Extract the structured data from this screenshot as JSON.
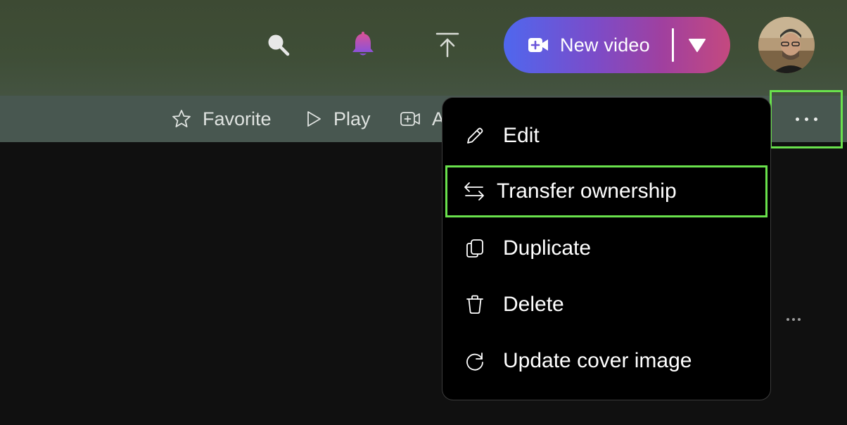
{
  "header": {
    "icons": [
      "search-icon",
      "bell-icon",
      "upload-icon"
    ],
    "new_video": {
      "label": "New video",
      "icon": "video-plus-icon",
      "caret": "chevron-down-icon"
    },
    "avatar": "user-avatar"
  },
  "toolbar": {
    "items": [
      {
        "label": "Favorite",
        "icon": "star-icon"
      },
      {
        "label": "Play",
        "icon": "play-icon"
      },
      {
        "label": "A",
        "icon": "add-video-icon"
      }
    ],
    "more_icon": "more-horizontal-icon"
  },
  "menu": {
    "items": [
      {
        "label": "Edit",
        "icon": "pencil-icon"
      },
      {
        "label": "Transfer ownership",
        "icon": "transfer-icon",
        "highlighted": true
      },
      {
        "label": "Duplicate",
        "icon": "copy-icon"
      },
      {
        "label": "Delete",
        "icon": "trash-icon"
      },
      {
        "label": "Update cover image",
        "icon": "refresh-icon"
      }
    ]
  },
  "colors": {
    "accent_highlight": "#69e14c",
    "header_bg": "#3f4e37",
    "toolbar_bg": "#485750",
    "menu_bg": "#000000",
    "page_bg": "#101010",
    "new_video_gradient_start": "#4f67ee",
    "new_video_gradient_end": "#c4497f"
  }
}
